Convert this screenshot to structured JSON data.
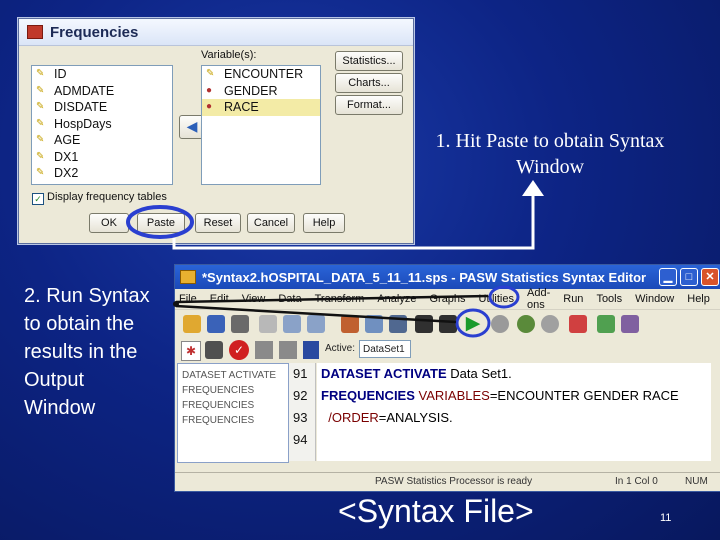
{
  "frequencies_dialog": {
    "title": "Frequencies",
    "variables_label": "Variable(s):",
    "source_variables": [
      "ID",
      "ADMDATE",
      "DISDATE",
      "HospDays",
      "AGE",
      "DX1",
      "DX2"
    ],
    "selected_variables": [
      "ENCOUNTER",
      "GENDER",
      "RACE"
    ],
    "display_tables_label": "Display frequency tables",
    "side_buttons": [
      "Statistics...",
      "Charts...",
      "Format..."
    ],
    "bottom_buttons": [
      "OK",
      "Paste",
      "Reset",
      "Cancel",
      "Help"
    ]
  },
  "callouts": {
    "step1": "1. Hit Paste to obtain Syntax Window",
    "step2": "2. Run Syntax\nto obtain the\nresults in the\nOutput\nWindow"
  },
  "syntax_editor": {
    "title": "*Syntax2.hOSPITAL_DATA_5_11_11.sps - PASW Statistics Syntax Editor",
    "menu": [
      "File",
      "Edit",
      "View",
      "Data",
      "Transform",
      "Analyze",
      "Graphs",
      "Utilities",
      "Add-ons",
      "Run",
      "Tools",
      "Window",
      "Help"
    ],
    "active_label": "Active:",
    "active_value": "DataSet1",
    "nav_items": [
      "DATASET ACTIVATE",
      "FREQUENCIES",
      "FREQUENCIES",
      "FREQUENCIES"
    ],
    "line_numbers": [
      "91",
      "92",
      "93",
      "94"
    ],
    "code_line1_kw": "DATASET ACTIVATE",
    "code_line1_rest": "Data Set1.",
    "code_line2_kw": "FREQUENCIES",
    "code_line2_sub": "VARIABLES",
    "code_line2_rest": "=ENCOUNTER GENDER RACE",
    "code_line3_sub": "/ORDER",
    "code_line3_rest": "=ANALYSIS.",
    "status_text": "PASW Statistics Processor is ready",
    "status_pos": "In 1 Col 0",
    "status_num": "NUM"
  },
  "footer": "<Syntax File>",
  "page_number": "11",
  "colors": {
    "background": "#0d2485",
    "callout_ring": "#2a3fd0",
    "arrow": "#ffffff"
  }
}
